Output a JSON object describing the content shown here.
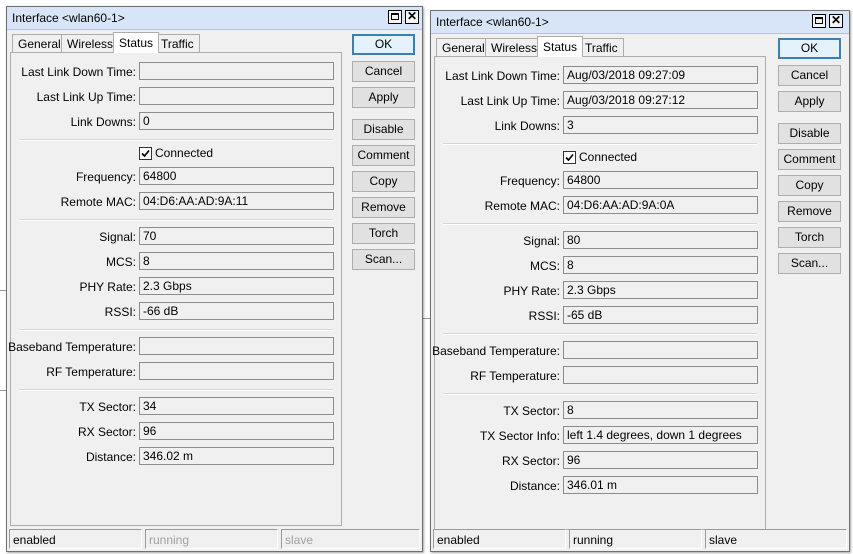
{
  "windows": [
    {
      "title": "Interface <wlan60-1>",
      "tabs": [
        "General",
        "Wireless",
        "Status",
        "Traffic"
      ],
      "active_tab": "Status",
      "fields": {
        "last_link_down_time": {
          "label": "Last Link Down Time:",
          "value": ""
        },
        "last_link_up_time": {
          "label": "Last Link Up Time:",
          "value": ""
        },
        "link_downs": {
          "label": "Link Downs:",
          "value": "0"
        },
        "connected": {
          "label": "Connected",
          "checked": true
        },
        "frequency": {
          "label": "Frequency:",
          "value": "64800"
        },
        "remote_mac": {
          "label": "Remote MAC:",
          "value": "04:D6:AA:AD:9A:11"
        },
        "signal": {
          "label": "Signal:",
          "value": "70"
        },
        "mcs": {
          "label": "MCS:",
          "value": "8"
        },
        "phy_rate": {
          "label": "PHY Rate:",
          "value": "2.3 Gbps"
        },
        "rssi": {
          "label": "RSSI:",
          "value": "-66 dB"
        },
        "baseband_temperature": {
          "label": "Baseband Temperature:",
          "value": ""
        },
        "rf_temperature": {
          "label": "RF Temperature:",
          "value": ""
        },
        "tx_sector": {
          "label": "TX Sector:",
          "value": "34"
        },
        "rx_sector": {
          "label": "RX Sector:",
          "value": "96"
        },
        "distance": {
          "label": "Distance:",
          "value": "346.02 m"
        }
      },
      "buttons": [
        "OK",
        "Cancel",
        "Apply",
        "Disable",
        "Comment",
        "Copy",
        "Remove",
        "Torch",
        "Scan..."
      ],
      "status": [
        "enabled",
        "running",
        "slave"
      ]
    },
    {
      "title": "Interface <wlan60-1>",
      "tabs": [
        "General",
        "Wireless",
        "Status",
        "Traffic"
      ],
      "active_tab": "Status",
      "fields": {
        "last_link_down_time": {
          "label": "Last Link Down Time:",
          "value": "Aug/03/2018 09:27:09"
        },
        "last_link_up_time": {
          "label": "Last Link Up Time:",
          "value": "Aug/03/2018 09:27:12"
        },
        "link_downs": {
          "label": "Link Downs:",
          "value": "3"
        },
        "connected": {
          "label": "Connected",
          "checked": true
        },
        "frequency": {
          "label": "Frequency:",
          "value": "64800"
        },
        "remote_mac": {
          "label": "Remote MAC:",
          "value": "04:D6:AA:AD:9A:0A"
        },
        "signal": {
          "label": "Signal:",
          "value": "80"
        },
        "mcs": {
          "label": "MCS:",
          "value": "8"
        },
        "phy_rate": {
          "label": "PHY Rate:",
          "value": "2.3 Gbps"
        },
        "rssi": {
          "label": "RSSI:",
          "value": "-65 dB"
        },
        "baseband_temperature": {
          "label": "Baseband Temperature:",
          "value": ""
        },
        "rf_temperature": {
          "label": "RF Temperature:",
          "value": ""
        },
        "tx_sector": {
          "label": "TX Sector:",
          "value": "8"
        },
        "tx_sector_info": {
          "label": "TX Sector Info:",
          "value": "left 1.4 degrees, down 1 degrees"
        },
        "rx_sector": {
          "label": "RX Sector:",
          "value": "96"
        },
        "distance": {
          "label": "Distance:",
          "value": "346.01 m"
        }
      },
      "buttons": [
        "OK",
        "Cancel",
        "Apply",
        "Disable",
        "Comment",
        "Copy",
        "Remove",
        "Torch",
        "Scan..."
      ],
      "status": [
        "enabled",
        "running",
        "slave"
      ]
    }
  ],
  "colors": {
    "titlebar": "#d8e4f8",
    "default_button_border": "#3c7fb1",
    "panel_background": "#f0f0f0"
  },
  "icons": {
    "maximize": "maximize-icon",
    "close": "close-icon",
    "checkbox_check": "checkmark-icon"
  }
}
